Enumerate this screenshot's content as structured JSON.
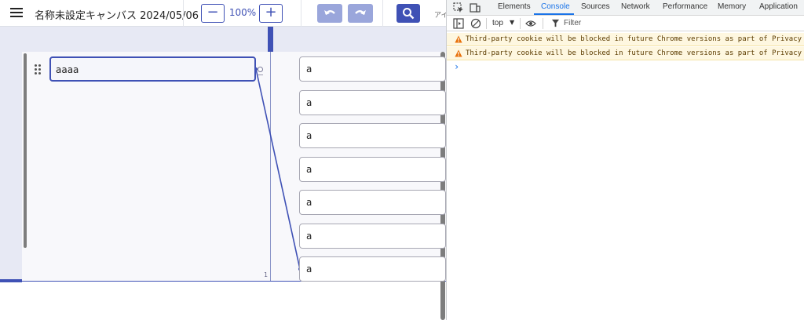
{
  "app": {
    "title": "名称未設定キャンバス 2024/05/06",
    "zoom_out_label": "−",
    "zoom_value": "100%",
    "zoom_in_label": "+",
    "truncated_label": "アイ",
    "accent": "#3f51b5",
    "icons": [
      "menu-icon",
      "undo-icon",
      "redo-icon",
      "search-icon"
    ]
  },
  "canvas": {
    "root_node": "aaaa",
    "child_nodes": [
      "a",
      "a",
      "a",
      "a",
      "a",
      "a",
      "a"
    ],
    "children_count": "1"
  },
  "devtools": {
    "tabs": [
      "Elements",
      "Console",
      "Sources",
      "Network",
      "Performance",
      "Memory",
      "Application"
    ],
    "active_tab": "Console",
    "context": "top",
    "filter_placeholder": "Filter",
    "messages": [
      "Third-party cookie will be blocked in future Chrome versions as part of Privacy Sandbox.",
      "Third-party cookie will be blocked in future Chrome versions as part of Privacy Sandbox."
    ],
    "prompt": "›",
    "warning_color": "#fef7e0"
  }
}
